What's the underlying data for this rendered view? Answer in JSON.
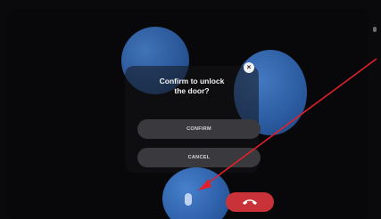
{
  "dialog": {
    "title": "Confirm to unlock\nthe door?",
    "close_glyph": "×",
    "confirm_label": "CONFIRM",
    "cancel_label": "CANCEL"
  },
  "controls": {
    "unlock_button_icon": "door-key-icon",
    "hangup_icon": "phone-hangup-icon"
  },
  "colors": {
    "accent_blue": "#2f64b0",
    "hangup_red": "#c93238",
    "annotation_arrow": "#e0202a"
  }
}
